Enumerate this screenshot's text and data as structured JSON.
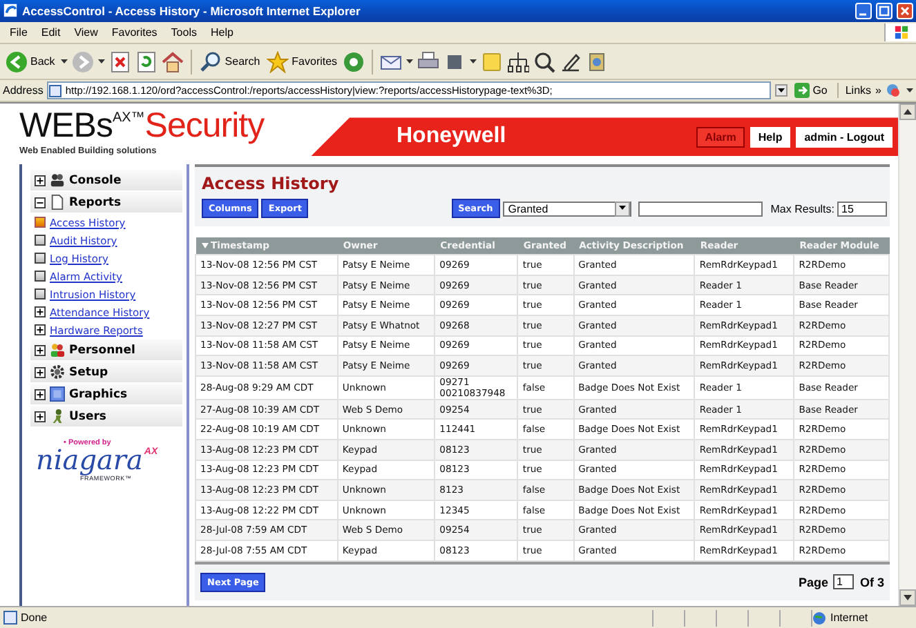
{
  "window": {
    "title": "AccessControl - Access History - Microsoft Internet Explorer"
  },
  "menu": [
    "File",
    "Edit",
    "View",
    "Favorites",
    "Tools",
    "Help"
  ],
  "toolbar": {
    "back": "Back",
    "search": "Search",
    "favorites": "Favorites"
  },
  "address_bar": {
    "label": "Address",
    "url": "http://192.168.1.120/ord?accessControl:/reports/accessHistory|view:?reports/accessHistorypage-text%3D;",
    "go": "Go",
    "links": "Links",
    "chevron": "»"
  },
  "header": {
    "logo": "WEBs",
    "logo_mark": "AX™",
    "logo_word": "Security",
    "tagline": "Web Enabled Building solutions",
    "brand": "Honeywell",
    "buttons": [
      {
        "label": "Alarm",
        "kind": "alarm"
      },
      {
        "label": "Help",
        "kind": "plain"
      },
      {
        "label": "admin - Logout",
        "kind": "plain"
      }
    ]
  },
  "sidebar": {
    "groups": [
      {
        "label": "Console",
        "kind": "console",
        "expanded": false
      },
      {
        "label": "Reports",
        "kind": "document",
        "expanded": true,
        "children": [
          {
            "label": "Access History",
            "kind": "page",
            "selected": true
          },
          {
            "label": "Audit History",
            "kind": "page",
            "selected": false
          },
          {
            "label": "Log History",
            "kind": "page",
            "selected": false
          },
          {
            "label": "Alarm Activity",
            "kind": "page",
            "selected": false
          },
          {
            "label": "Intrusion History",
            "kind": "page",
            "selected": false
          },
          {
            "label": "Attendance History",
            "kind": "folder",
            "selected": false
          },
          {
            "label": "Hardware Reports",
            "kind": "folder",
            "selected": false
          }
        ]
      },
      {
        "label": "Personnel",
        "kind": "people",
        "expanded": false
      },
      {
        "label": "Setup",
        "kind": "gear",
        "expanded": false
      },
      {
        "label": "Graphics",
        "kind": "picture",
        "expanded": false
      },
      {
        "label": "Users",
        "kind": "user",
        "expanded": false
      }
    ],
    "powered_by": "• Powered by",
    "framework_name": "niagara",
    "framework_mark": "AX",
    "framework_tag": "FRAMEWORK™"
  },
  "main": {
    "title": "Access History",
    "buttons": [
      "Columns",
      "Export"
    ],
    "search": {
      "button": "Search",
      "filter": "Granted",
      "max_label": "Max Results:",
      "max_value": "15"
    },
    "columns": [
      {
        "label": "Timestamp",
        "sorted": true
      },
      {
        "label": "Owner",
        "sorted": false
      },
      {
        "label": "Credential",
        "sorted": false
      },
      {
        "label": "Granted",
        "sorted": false
      },
      {
        "label": "Activity Description",
        "sorted": false
      },
      {
        "label": "Reader",
        "sorted": false
      },
      {
        "label": "Reader Module",
        "sorted": false
      }
    ],
    "rows": [
      [
        "13-Nov-08 12:56 PM CST",
        "Patsy E Neime",
        "09269",
        "true",
        "Granted",
        "RemRdrKeypad1",
        "R2RDemo"
      ],
      [
        "13-Nov-08 12:56 PM CST",
        "Patsy E Neime",
        "09269",
        "true",
        "Granted",
        "Reader 1",
        "Base Reader"
      ],
      [
        "13-Nov-08 12:56 PM CST",
        "Patsy E Neime",
        "09269",
        "true",
        "Granted",
        "Reader 1",
        "Base Reader"
      ],
      [
        "13-Nov-08 12:27 PM CST",
        "Patsy E Whatnot",
        "09268",
        "true",
        "Granted",
        "RemRdrKeypad1",
        "R2RDemo"
      ],
      [
        "13-Nov-08 11:58 AM CST",
        "Patsy E Neime",
        "09269",
        "true",
        "Granted",
        "RemRdrKeypad1",
        "R2RDemo"
      ],
      [
        "13-Nov-08 11:58 AM CST",
        "Patsy E Neime",
        "09269",
        "true",
        "Granted",
        "RemRdrKeypad1",
        "R2RDemo"
      ],
      [
        "28-Aug-08 9:29 AM CDT",
        "Unknown",
        "09271\n00210837948",
        "false",
        "Badge Does Not Exist",
        "Reader 1",
        "Base Reader"
      ],
      [
        "27-Aug-08 10:39 AM CDT",
        "Web S Demo",
        "09254",
        "true",
        "Granted",
        "Reader 1",
        "Base Reader"
      ],
      [
        "22-Aug-08 10:19 AM CDT",
        "Unknown",
        "112441",
        "false",
        "Badge Does Not Exist",
        "RemRdrKeypad1",
        "R2RDemo"
      ],
      [
        "13-Aug-08 12:23 PM CDT",
        "Keypad",
        "08123",
        "true",
        "Granted",
        "RemRdrKeypad1",
        "R2RDemo"
      ],
      [
        "13-Aug-08 12:23 PM CDT",
        "Keypad",
        "08123",
        "true",
        "Granted",
        "RemRdrKeypad1",
        "R2RDemo"
      ],
      [
        "13-Aug-08 12:23 PM CDT",
        "Unknown",
        "8123",
        "false",
        "Badge Does Not Exist",
        "RemRdrKeypad1",
        "R2RDemo"
      ],
      [
        "13-Aug-08 12:22 PM CDT",
        "Unknown",
        "12345",
        "false",
        "Badge Does Not Exist",
        "RemRdrKeypad1",
        "R2RDemo"
      ],
      [
        "28-Jul-08 7:59 AM CDT",
        "Web S Demo",
        "09254",
        "true",
        "Granted",
        "RemRdrKeypad1",
        "R2RDemo"
      ],
      [
        "28-Jul-08 7:55 AM CDT",
        "Keypad",
        "08123",
        "true",
        "Granted",
        "RemRdrKeypad1",
        "R2RDemo"
      ]
    ],
    "footer": {
      "next": "Next Page",
      "page_label": "Page",
      "page_value": "1",
      "page_total": "Of 3"
    }
  },
  "status_bar": {
    "text": "Done",
    "zone": "Internet"
  }
}
